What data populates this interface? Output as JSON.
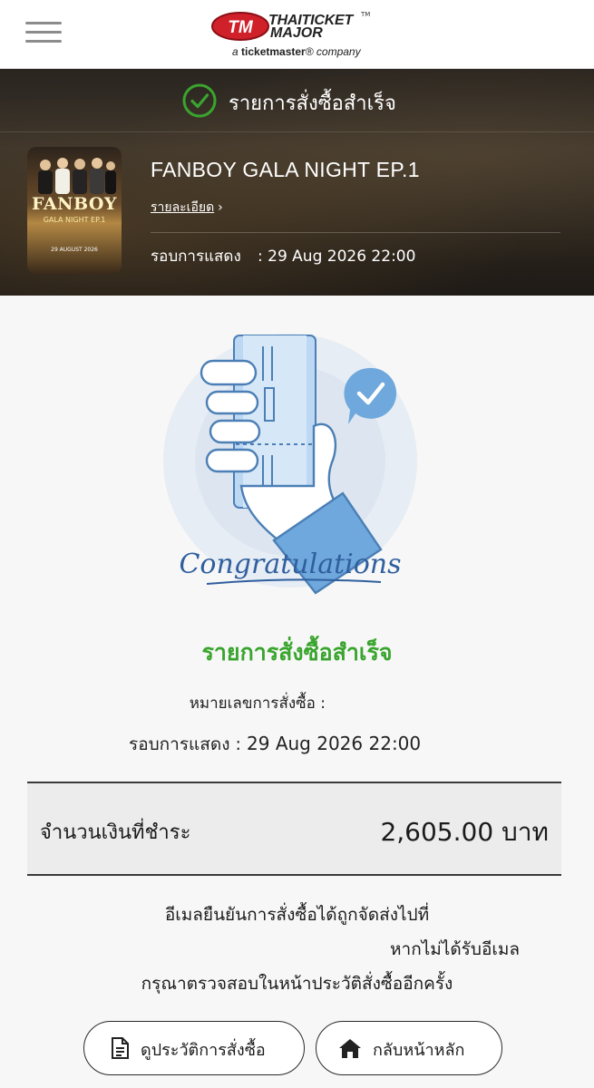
{
  "header": {
    "logo_line1": "THAITICKET",
    "logo_line2": "MAJOR",
    "logo_tm": "TM",
    "logo_badge": "TM",
    "logo_tagline_prefix": "a ",
    "logo_tagline_brand": "ticketmaster",
    "logo_tagline_suffix": "® company",
    "menu_icon": "hamburger-menu-icon"
  },
  "banner": {
    "status_title": "รายการสั่งซื้อสำเร็จ",
    "status_icon": "check-circle-icon",
    "event_name": "FANBOY GALA NIGHT EP.1",
    "detail_link": "รายละเอียด",
    "show_label": "รอบการแสดง",
    "show_value": ": 29 Aug 2026 22:00",
    "poster": {
      "title": "FANBOY",
      "subtitle": "GALA NIGHT EP.1",
      "date": "29 AUGUST 2026"
    }
  },
  "illustration": {
    "caption": "Congratulations",
    "icon": "hand-holding-ticket-icon"
  },
  "success": {
    "title": "รายการสั่งซื้อสำเร็จ",
    "order_label": "หมายเลขการสั่งซื้อ :",
    "order_value": "",
    "show_label": "รอบการแสดง :",
    "show_value": "29 Aug 2026 22:00"
  },
  "payment": {
    "label": "จำนวนเงินที่ชำระ",
    "amount": "2,605.00 บาท"
  },
  "note": {
    "line1": "อีเมลยืนยันการสั่งซื้อได้ถูกจัดส่งไปที่",
    "line2": "หากไม่ได้รับอีเมล",
    "line3": "กรุณาตรวจสอบในหน้าประวัติสั่งซื้ออีกครั้ง"
  },
  "buttons": {
    "history": "ดูประวัติการสั่งซื้อ",
    "home": "กลับหน้าหลัก"
  },
  "colors": {
    "success_green": "#3aa52e",
    "banner_bg": "#2b251d",
    "illustration_blue": "#6fa8dc",
    "brand_red": "#d0202a"
  }
}
